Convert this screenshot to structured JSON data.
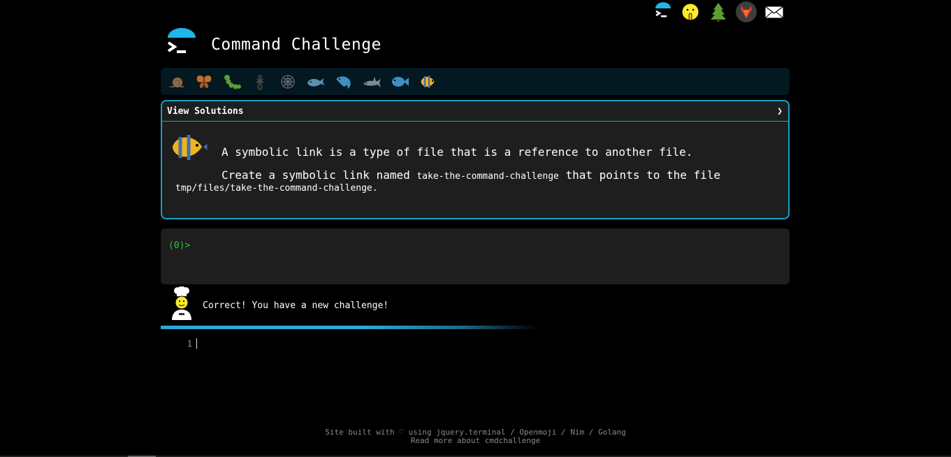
{
  "header": {
    "title": "Command Challenge"
  },
  "top_icons": [
    "terminal-icon",
    "shushing-face-icon",
    "tree-icon",
    "gitlab-icon",
    "envelope-icon"
  ],
  "levels": [
    "snail-icon",
    "butterfly-icon",
    "caterpillar-icon",
    "ant-icon",
    "web-icon",
    "whale-icon",
    "dolphin-icon",
    "shark-icon",
    "fish-icon",
    "tropical-fish-icon"
  ],
  "challenge": {
    "toggle_label": "View Solutions",
    "chevron": "❯",
    "line1": "A symbolic link is a type of file that is a reference to another file.",
    "line2_pre": "Create a symbolic link named ",
    "line2_code": "take-the-command-challenge",
    "line2_post": " that points to the file",
    "line3_code": "tmp/files/take-the-command-challenge",
    "line3_post": "."
  },
  "terminal": {
    "prompt": "(0)>"
  },
  "chef": {
    "message": "Correct! You have a new challenge!"
  },
  "editor": {
    "line_number": "1"
  },
  "footer": {
    "line1_pre": "Site built with ♡ using ",
    "link_jquery": "jquery.terminal",
    "sep1": " / ",
    "link_openmoji": "Openmoji",
    "sep2": " / ",
    "link_nim": "Nim",
    "sep3": " / ",
    "link_golang": "Golang",
    "line2": "Read more about cmdchallenge"
  },
  "colors": {
    "accent": "#17a2c8",
    "prompt": "#27c93f",
    "panel": "#1e1e1e",
    "level_bar": "#031820"
  }
}
